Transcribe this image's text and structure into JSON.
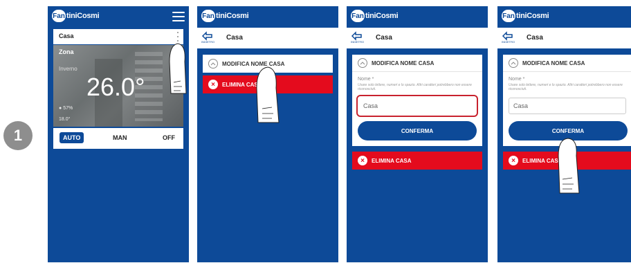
{
  "step_number": "1",
  "brand": {
    "mark": "Fan",
    "name": "tiniCosmi"
  },
  "screen1": {
    "card_title": "Casa",
    "zone_name": "Zona",
    "season": "Inverno",
    "temperature": "26.0°",
    "humidity": "57%",
    "external_temp": "18.0°",
    "modes": [
      "AUTO",
      "MAN",
      "OFF"
    ],
    "active_mode": "AUTO"
  },
  "screen2": {
    "back_label": "INDIETRO",
    "title": "Casa",
    "rename_label": "MODIFICA NOME CASA",
    "delete_label": "ELIMINA CASA"
  },
  "screen3": {
    "back_label": "INDIETRO",
    "title": "Casa",
    "rename_label": "MODIFICA NOME CASA",
    "name_label": "Nome *",
    "hint": "Usare solo lettere, numeri e lo spazio. Altri caratteri potrebbero non essere riconosciuti.",
    "input_value": "Casa",
    "confirm_label": "CONFERMA",
    "delete_label": "ELIMINA CASA"
  },
  "screen4": {
    "back_label": "INDIETRO",
    "title": "Casa",
    "rename_label": "MODIFICA NOME CASA",
    "name_label": "Nome *",
    "hint": "Usare solo lettere, numeri e lo spazio. Altri caratteri potrebbero non essere riconosciuti.",
    "input_value": "Casa",
    "confirm_label": "CONFERMA",
    "delete_label": "ELIMINA CASA"
  },
  "colors": {
    "brand_blue": "#0d4a98",
    "danger_red": "#e40b1d",
    "highlight": "#c8222e",
    "step_badge": "#8e8e8e"
  },
  "icons": [
    "menu-icon",
    "kebab-icon",
    "back-icon",
    "chevron-up-icon",
    "close-circle-icon",
    "humidity-icon",
    "hand-pointer-icon"
  ]
}
